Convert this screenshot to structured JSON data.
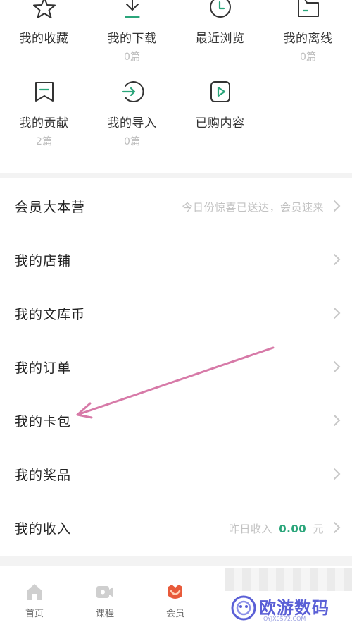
{
  "grid": {
    "row1": [
      {
        "label": "我的收藏",
        "count": "",
        "icon": "star-icon"
      },
      {
        "label": "我的下载",
        "count": "0篇",
        "icon": "download-icon"
      },
      {
        "label": "最近浏览",
        "count": "",
        "icon": "clock-icon"
      },
      {
        "label": "我的离线",
        "count": "0篇",
        "icon": "folder-icon"
      }
    ],
    "row2": [
      {
        "label": "我的贡献",
        "count": "2篇",
        "icon": "contribution-icon"
      },
      {
        "label": "我的导入",
        "count": "0篇",
        "icon": "import-icon"
      },
      {
        "label": "已购内容",
        "count": "",
        "icon": "purchased-icon"
      }
    ]
  },
  "list": [
    {
      "title": "会员大本营",
      "hint": "今日份惊喜已送达，会员速来"
    },
    {
      "title": "我的店铺",
      "hint": ""
    },
    {
      "title": "我的文库币",
      "hint": ""
    },
    {
      "title": "我的订单",
      "hint": ""
    },
    {
      "title": "我的卡包",
      "hint": ""
    },
    {
      "title": "我的奖品",
      "hint": ""
    },
    {
      "title": "我的收入",
      "hint_prefix": "昨日收入",
      "hint_amount": "0.00",
      "hint_suffix": "元"
    }
  ],
  "tabbar": {
    "tabs": [
      {
        "label": "首页",
        "icon": "home-icon"
      },
      {
        "label": "课程",
        "icon": "course-icon"
      },
      {
        "label": "会员",
        "icon": "vip-icon"
      }
    ]
  },
  "watermark": {
    "text": "欧游数码",
    "sub": "OYJX0572.COM",
    "icon": "watermark-logo-icon"
  },
  "colors": {
    "accent": "#2aa57a",
    "arrow": "#d77aa8",
    "watermark": "#5a5fd6",
    "vip": "#e85a3a"
  }
}
